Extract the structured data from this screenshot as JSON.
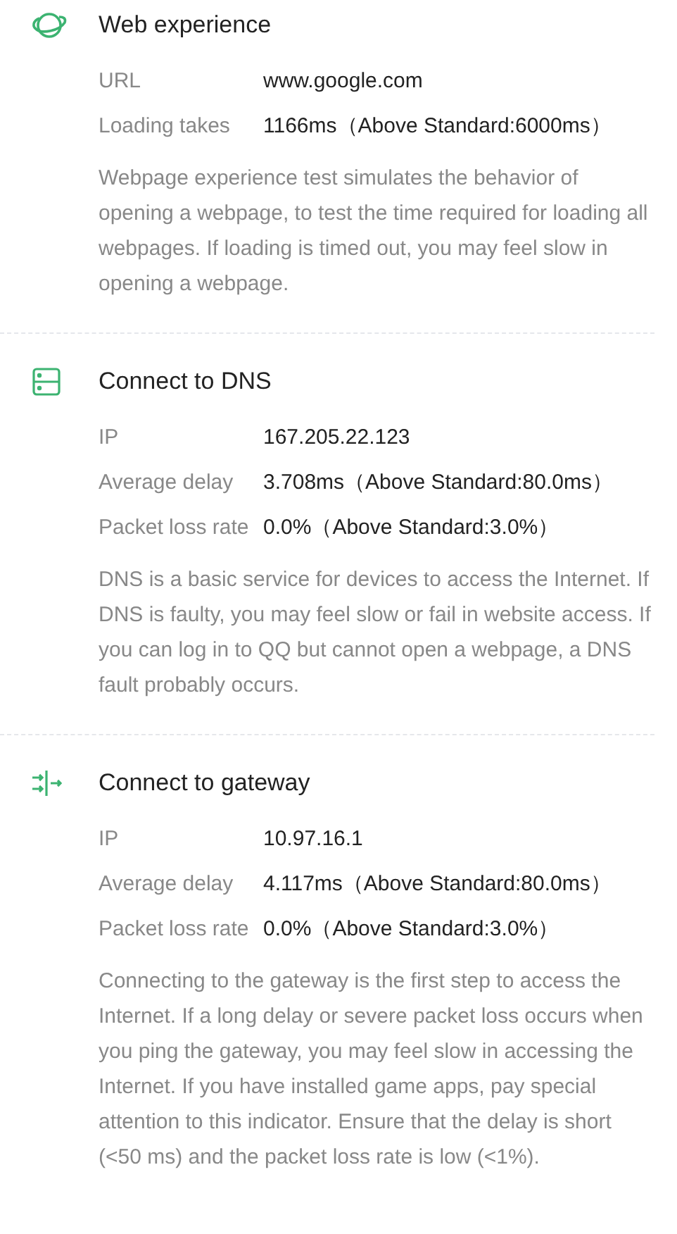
{
  "sections": [
    {
      "kind": "web",
      "title": "Web experience",
      "rows": [
        {
          "label": "URL",
          "value": "www.google.com"
        },
        {
          "label": "Loading takes",
          "value": "1166ms（Above Standard:6000ms）"
        }
      ],
      "description": "Webpage experience test simulates the behavior of opening a webpage, to test the time required for loading all webpages. If loading is timed out, you may feel slow in opening a webpage."
    },
    {
      "kind": "dns",
      "title": "Connect to DNS",
      "rows": [
        {
          "label": "IP",
          "value": "167.205.22.123"
        },
        {
          "label": "Average delay",
          "value": "3.708ms（Above Standard:80.0ms）"
        },
        {
          "label": "Packet loss rate",
          "value": "0.0%（Above Standard:3.0%）"
        }
      ],
      "description": "DNS is a basic service for devices to access the Internet. If DNS is faulty, you may feel slow or fail in website access. If you can log in to QQ but cannot open a webpage, a DNS fault probably occurs."
    },
    {
      "kind": "gateway",
      "title": "Connect to gateway",
      "rows": [
        {
          "label": "IP",
          "value": "10.97.16.1"
        },
        {
          "label": "Average delay",
          "value": "4.117ms（Above Standard:80.0ms）"
        },
        {
          "label": "Packet loss rate",
          "value": "0.0%（Above Standard:3.0%）"
        }
      ],
      "description": "Connecting to the gateway is the first step to access the Internet. If a long delay or severe packet loss occurs when you ping the gateway, you may feel slow in accessing the Internet. If you have installed game apps, pay special attention to this indicator. Ensure that the delay is short (<50 ms) and the packet loss rate is low (<1%)."
    }
  ]
}
